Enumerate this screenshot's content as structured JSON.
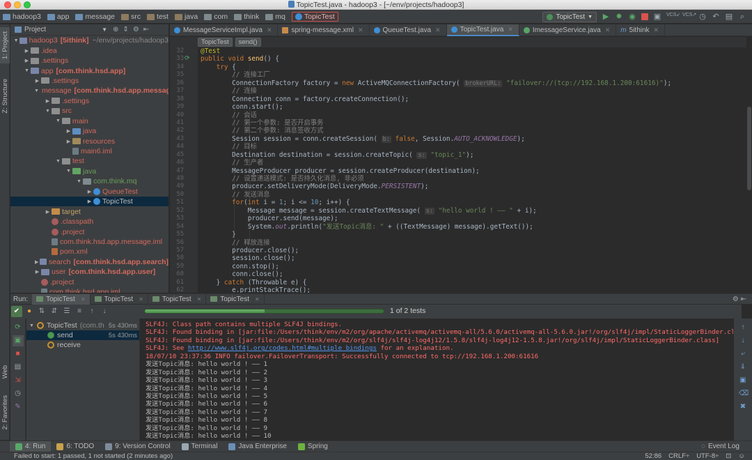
{
  "window": {
    "title": "TopicTest.java - hadoop3 - [~/env/projects/hadoop3]"
  },
  "breadcrumbs": [
    "hadoop3",
    "app",
    "message",
    "src",
    "test",
    "java",
    "com",
    "think",
    "mq",
    "TopicTest"
  ],
  "toolbar": {
    "run_config": "TopicTest",
    "vcs_label": "VCS"
  },
  "side_tabs": {
    "project": "1: Project",
    "structure": "Z: Structure",
    "web": "Web",
    "favorites": "2: Favorites"
  },
  "project_panel": {
    "title": "Project",
    "tree": [
      {
        "label": "hadoop3",
        "suffix": "[5ithink]",
        "hint": "~/env/projects/hadoop3",
        "depth": 0,
        "expanded": true,
        "icon": "folder-module-icon",
        "style": "red"
      },
      {
        "label": ".idea",
        "depth": 1,
        "expanded": false,
        "icon": "folder-icon",
        "style": "red"
      },
      {
        "label": ".settings",
        "depth": 1,
        "expanded": false,
        "icon": "folder-icon",
        "style": "red"
      },
      {
        "label": "app",
        "suffix": "[com.think.hsd.app]",
        "depth": 1,
        "expanded": true,
        "icon": "folder-module-icon",
        "style": "red"
      },
      {
        "label": ".settings",
        "depth": 2,
        "expanded": false,
        "icon": "folder-icon",
        "style": "red"
      },
      {
        "label": "message",
        "suffix": "[com.think.hsd.app.message]",
        "depth": 2,
        "expanded": true,
        "icon": "folder-module-icon",
        "style": "red"
      },
      {
        "label": ".settings",
        "depth": 3,
        "expanded": false,
        "icon": "folder-icon",
        "style": "red"
      },
      {
        "label": "src",
        "depth": 3,
        "expanded": true,
        "icon": "folder-icon",
        "style": "red"
      },
      {
        "label": "main",
        "depth": 4,
        "expanded": true,
        "icon": "folder-icon",
        "style": "red"
      },
      {
        "label": "java",
        "depth": 5,
        "expanded": false,
        "icon": "folder-source-icon",
        "style": "red"
      },
      {
        "label": "resources",
        "depth": 5,
        "expanded": false,
        "icon": "folder-resources-icon",
        "style": "red"
      },
      {
        "label": "main6.iml",
        "depth": 5,
        "leaf": true,
        "icon": "iml-file-icon",
        "style": "red"
      },
      {
        "label": "test",
        "depth": 4,
        "expanded": true,
        "icon": "folder-icon",
        "style": "red"
      },
      {
        "label": "java",
        "depth": 5,
        "expanded": true,
        "icon": "folder-test-icon",
        "style": "green"
      },
      {
        "label": "com.think.mq",
        "depth": 6,
        "expanded": true,
        "icon": "package-icon",
        "style": "green"
      },
      {
        "label": "QueueTest",
        "depth": 7,
        "expanded": false,
        "icon": "class-icon",
        "style": "red"
      },
      {
        "label": "TopicTest",
        "depth": 7,
        "expanded": false,
        "icon": "class-icon",
        "style": "plain",
        "selected": true
      },
      {
        "label": "target",
        "depth": 3,
        "expanded": false,
        "icon": "folder-excluded-icon",
        "style": "orange"
      },
      {
        "label": ".classpath",
        "depth": 3,
        "leaf": true,
        "icon": "dot-file-icon",
        "style": "red"
      },
      {
        "label": ".project",
        "depth": 3,
        "leaf": true,
        "icon": "dot-file-icon",
        "style": "red"
      },
      {
        "label": "com.think.hsd.app.message.iml",
        "depth": 3,
        "leaf": true,
        "icon": "iml-file-icon",
        "style": "red"
      },
      {
        "label": "pom.xml",
        "depth": 3,
        "leaf": true,
        "icon": "maven-file-icon",
        "style": "red"
      },
      {
        "label": "search",
        "suffix": "[com.think.hsd.app.search]",
        "depth": 2,
        "expanded": false,
        "icon": "folder-module-icon",
        "style": "red"
      },
      {
        "label": "user",
        "suffix": "[com.think.hsd.app.user]",
        "depth": 2,
        "expanded": false,
        "icon": "folder-module-icon",
        "style": "red"
      },
      {
        "label": ".project",
        "depth": 2,
        "leaf": true,
        "icon": "dot-file-icon",
        "style": "red"
      },
      {
        "label": "com.think.hsd.app.iml",
        "depth": 2,
        "leaf": true,
        "icon": "iml-file-icon",
        "style": "red"
      }
    ]
  },
  "editor": {
    "tabs": [
      {
        "label": "MessageServiceImpl.java",
        "icon": "class-icon",
        "active": false
      },
      {
        "label": "spring-message.xml",
        "icon": "xml-file-icon",
        "active": false
      },
      {
        "label": "QueueTest.java",
        "icon": "class-icon",
        "active": false
      },
      {
        "label": "TopicTest.java",
        "icon": "class-icon",
        "active": true
      },
      {
        "label": "ImessageService.java",
        "icon": "interface-icon",
        "active": false
      },
      {
        "label": "5ithink",
        "icon": "maven-module-icon",
        "active": false
      }
    ],
    "breadcrumb": [
      "TopicTest",
      "send()"
    ]
  },
  "run_window": {
    "label": "Run:",
    "tabs": [
      "TopicTest",
      "TopicTest",
      "TopicTest",
      "TopicTest"
    ],
    "progress_fraction": 0.5,
    "tests_count": "1 of 2 tests",
    "test_tree": [
      {
        "label": "TopicTest",
        "suffix": "(com.th",
        "time": "5s 430ms",
        "icon": "pending-icon",
        "depth": 0
      },
      {
        "label": "send",
        "time": "5s 430ms",
        "icon": "ok-icon",
        "depth": 1,
        "selected": true
      },
      {
        "label": "receive",
        "time": "",
        "icon": "pending-icon",
        "depth": 1
      }
    ],
    "console_link": "http://www.slf4j.org/codes.html#multiple_bindings",
    "console_lines": [
      {
        "type": "err",
        "text": "SLF4J: Class path contains multiple SLF4J bindings."
      },
      {
        "type": "err",
        "text": "SLF4J: Found binding in [jar:file:/Users/think/env/m2/org/apache/activemq/activemq-all/5.6.0/activemq-all-5.6.0.jar!/org/slf4j/impl/StaticLoggerBinder.class]"
      },
      {
        "type": "err",
        "text": "SLF4J: Found binding in [jar:file:/Users/think/env/m2/org/slf4j/slf4j-log4j12/1.5.8/slf4j-log4j12-1.5.8.jar!/org/slf4j/impl/StaticLoggerBinder.class]"
      },
      {
        "type": "err-link",
        "pre": "SLF4J: See ",
        "post": " for an explanation."
      },
      {
        "type": "err",
        "text": "18/07/10 23:37:36 INFO failover.FailoverTransport: Successfully connected to tcp://192.168.1.200:61616"
      },
      {
        "type": "out",
        "text": "发送Topic消息: hello world ! —— 1"
      },
      {
        "type": "out",
        "text": "发送Topic消息: hello world ! —— 2"
      },
      {
        "type": "out",
        "text": "发送Topic消息: hello world ! —— 3"
      },
      {
        "type": "out",
        "text": "发送Topic消息: hello world ! —— 4"
      },
      {
        "type": "out",
        "text": "发送Topic消息: hello world ! —— 5"
      },
      {
        "type": "out",
        "text": "发送Topic消息: hello world ! —— 6"
      },
      {
        "type": "out",
        "text": "发送Topic消息: hello world ! —— 7"
      },
      {
        "type": "out",
        "text": "发送Topic消息: hello world ! —— 8"
      },
      {
        "type": "out",
        "text": "发送Topic消息: hello world ! —— 9"
      },
      {
        "type": "out",
        "text": "发送Topic消息: hello world ! —— 10"
      }
    ]
  },
  "bottom_tools": [
    {
      "label": "4: Run",
      "icon": "run-icon",
      "active": true
    },
    {
      "label": "6: TODO",
      "icon": "todo-icon",
      "active": false
    },
    {
      "label": "9: Version Control",
      "icon": "vcs-icon",
      "active": false
    },
    {
      "label": "Terminal",
      "icon": "terminal-icon",
      "active": false
    },
    {
      "label": "Java Enterprise",
      "icon": "java-enterprise-icon",
      "active": false
    },
    {
      "label": "Spring",
      "icon": "spring-icon",
      "active": false
    }
  ],
  "event_log": "Event Log",
  "status": {
    "message": "Failed to start: 1 passed, 1 not started (2 minutes ago)",
    "position": "52:86",
    "line_separator": "CRLF÷",
    "encoding": "UTF-8÷"
  },
  "colors": {
    "accent": "#4a88c7",
    "error_text": "#ff6b68",
    "pass_green": "#4c9a52",
    "editor_bg": "#2b2b2b",
    "panel_bg": "#3c3f41"
  }
}
